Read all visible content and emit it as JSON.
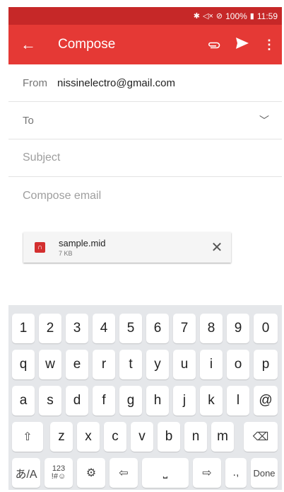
{
  "status": {
    "icons": [
      "bluetooth-icon",
      "mute-icon",
      "blocked-icon"
    ],
    "battery": "100%",
    "time": "11:59"
  },
  "toolbar": {
    "title": "Compose",
    "back_icon": "arrow-back-icon",
    "attach_icon": "paperclip-icon",
    "send_icon": "send-icon",
    "more_icon": "more-vert-icon"
  },
  "form": {
    "from_label": "From",
    "from_value": "nissinelectro@gmail.com",
    "to_label": "To",
    "subject_placeholder": "Subject",
    "body_placeholder": "Compose email"
  },
  "attachment": {
    "name": "sample.mid",
    "size": "7 KB",
    "close": "✕"
  },
  "keyboard": {
    "row1": [
      "1",
      "2",
      "3",
      "4",
      "5",
      "6",
      "7",
      "8",
      "9",
      "0"
    ],
    "row2": [
      "q",
      "w",
      "e",
      "r",
      "t",
      "y",
      "u",
      "i",
      "o",
      "p"
    ],
    "row3": [
      "a",
      "s",
      "d",
      "f",
      "g",
      "h",
      "j",
      "k",
      "l",
      "@"
    ],
    "row4": [
      "z",
      "x",
      "c",
      "v",
      "b",
      "n",
      "m"
    ],
    "lang": "あ/A",
    "sym": "123\n!#☺",
    "done": "Done",
    "punct": ".,"
  },
  "colors": {
    "status_bar": "#c62828",
    "toolbar": "#e53935",
    "keyboard_bg": "#e5e7ea"
  }
}
